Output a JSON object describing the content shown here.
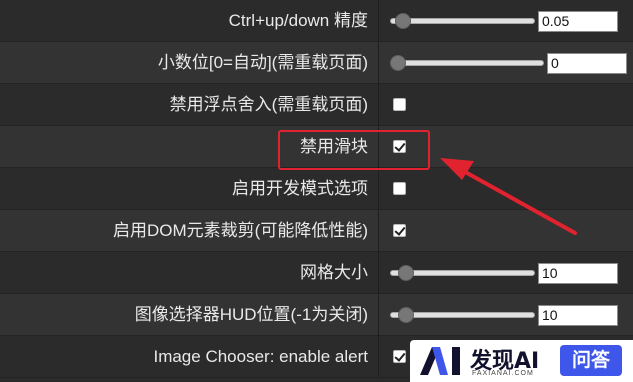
{
  "settings": {
    "rows": [
      {
        "label": "Ctrl+up/down 精度",
        "type": "slider",
        "value": "0.05",
        "slider_level": 0.04
      },
      {
        "label": "小数位[0=自动](需重载页面)",
        "type": "slider",
        "value": "0",
        "slider_level": 0.0
      },
      {
        "label": "禁用浮点舍入(需重载页面)",
        "type": "checkbox",
        "checked": false
      },
      {
        "label": "禁用滑块",
        "type": "checkbox",
        "checked": true
      },
      {
        "label": "启用开发模式选项",
        "type": "checkbox",
        "checked": false
      },
      {
        "label": "启用DOM元素裁剪(可能降低性能)",
        "type": "checkbox",
        "checked": true
      },
      {
        "label": "网格大小",
        "type": "slider",
        "value": "10",
        "slider_level": 0.06
      },
      {
        "label": "图像选择器HUD位置(-1为关闭)",
        "type": "slider",
        "value": "10",
        "slider_level": 0.06
      },
      {
        "label": "Image Chooser: enable alert",
        "type": "checkbox",
        "checked": true
      }
    ]
  },
  "annotation": {
    "highlight_color": "#e0232f"
  },
  "watermark": {
    "logo": "AI",
    "title": "发现AI",
    "subtitle": "FAXIANAI.COM",
    "button": "问答"
  },
  "colors": {
    "background": "#2b2b2b",
    "row_alt": "#333333",
    "text": "#e9e9e9",
    "watermark_button": "#3e56ea"
  }
}
